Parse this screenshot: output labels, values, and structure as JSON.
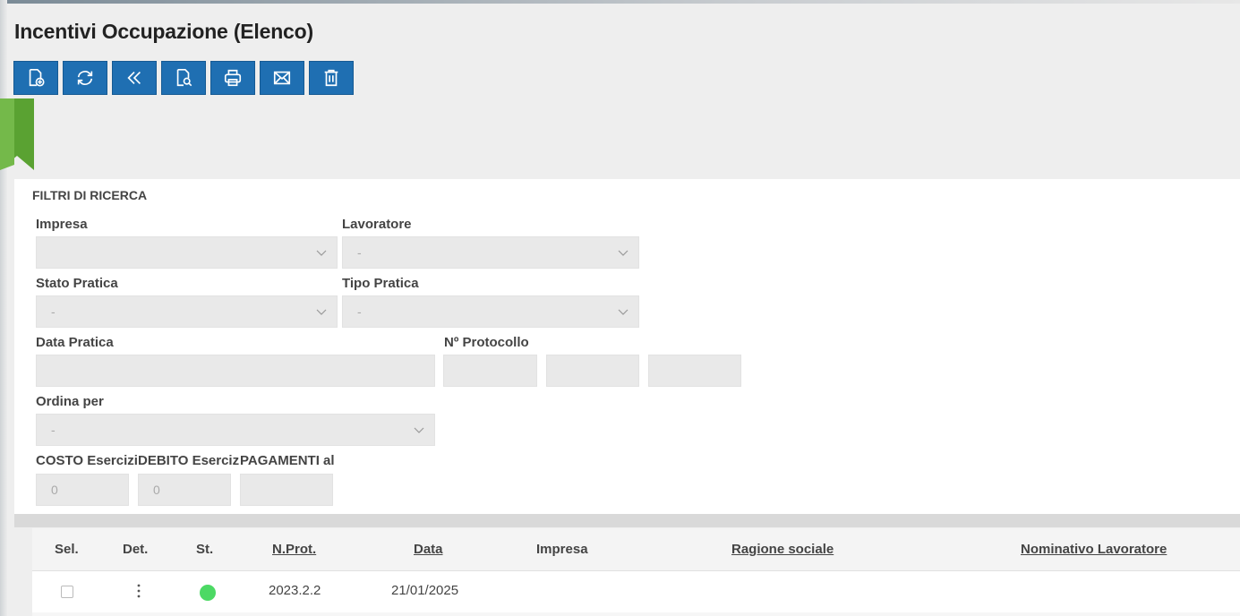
{
  "page": {
    "title": "Incentivi Occupazione (Elenco)"
  },
  "toolbar": {
    "buttons": [
      {
        "icon": "new-document-icon"
      },
      {
        "icon": "refresh-icon"
      },
      {
        "icon": "double-chevron-left-icon"
      },
      {
        "icon": "document-search-icon"
      },
      {
        "icon": "print-icon"
      },
      {
        "icon": "mail-icon"
      },
      {
        "icon": "trash-icon"
      }
    ],
    "accent": "#1f6fb2"
  },
  "bookmark_color": "#5aa232",
  "filters": {
    "title": "FILTRI DI RICERCA",
    "impresa": {
      "label": "Impresa",
      "value": ""
    },
    "lavoratore": {
      "label": "Lavoratore",
      "value": "-"
    },
    "stato_pratica": {
      "label": "Stato Pratica",
      "value": "-"
    },
    "tipo_pratica": {
      "label": "Tipo Pratica",
      "value": "-"
    },
    "data_pratica": {
      "label": "Data Pratica",
      "value": ""
    },
    "protocollo": {
      "label": "Nº Protocollo",
      "values": [
        "",
        "",
        ""
      ]
    },
    "ordina_per": {
      "label": "Ordina per",
      "value": "-"
    },
    "costo": {
      "label": "COSTO Esercizio",
      "value": "0"
    },
    "debito": {
      "label": "DEBITO Esercizio",
      "value": "0"
    },
    "pagamenti": {
      "label": "PAGAMENTI al",
      "value": ""
    }
  },
  "table": {
    "columns": [
      "Sel.",
      "Det.",
      "St.",
      "N.Prot.",
      "Data",
      "Impresa",
      "Ragione sociale",
      "Nominativo Lavoratore"
    ],
    "rows": [
      {
        "prot": "2023.2.2",
        "data": "21/01/2025",
        "impresa": "",
        "ragione": "",
        "lavoratore": "",
        "status_color": "#4cd964"
      }
    ]
  }
}
